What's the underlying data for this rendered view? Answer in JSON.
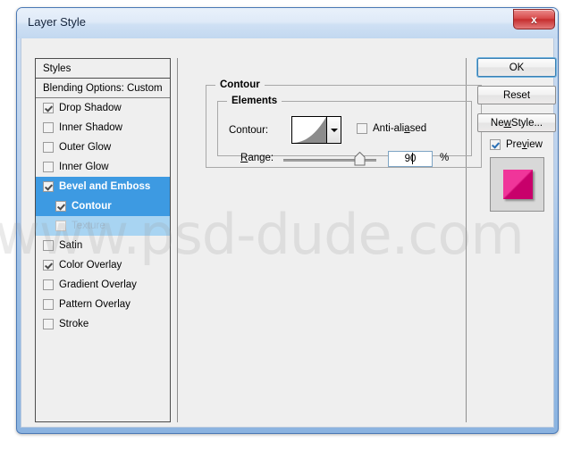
{
  "window": {
    "title": "Layer Style",
    "close_label": "x",
    "close_icon": "close-icon"
  },
  "styles_panel": {
    "header": "Styles",
    "blending_options": "Blending Options: Custom",
    "items": [
      {
        "label": "Drop Shadow",
        "checked": true,
        "selected": false,
        "sub": false,
        "disabled": false
      },
      {
        "label": "Inner Shadow",
        "checked": false,
        "selected": false,
        "sub": false,
        "disabled": false
      },
      {
        "label": "Outer Glow",
        "checked": false,
        "selected": false,
        "sub": false,
        "disabled": false
      },
      {
        "label": "Inner Glow",
        "checked": false,
        "selected": false,
        "sub": false,
        "disabled": false
      },
      {
        "label": "Bevel and Emboss",
        "checked": true,
        "selected": true,
        "sub": false,
        "disabled": false
      },
      {
        "label": "Contour",
        "checked": true,
        "selected": true,
        "sub": true,
        "disabled": false
      },
      {
        "label": "Texture",
        "checked": false,
        "selected": true,
        "sub": true,
        "disabled": true
      },
      {
        "label": "Satin",
        "checked": false,
        "selected": false,
        "sub": false,
        "disabled": false
      },
      {
        "label": "Color Overlay",
        "checked": true,
        "selected": false,
        "sub": false,
        "disabled": false
      },
      {
        "label": "Gradient Overlay",
        "checked": false,
        "selected": false,
        "sub": false,
        "disabled": false
      },
      {
        "label": "Pattern Overlay",
        "checked": false,
        "selected": false,
        "sub": false,
        "disabled": false
      },
      {
        "label": "Stroke",
        "checked": false,
        "selected": false,
        "sub": false,
        "disabled": false
      }
    ]
  },
  "main": {
    "group_title": "Contour",
    "elements_title": "Elements",
    "contour_label": "Contour:",
    "contour_preset_icon": "contour-curve-swatch",
    "contour_dropdown_icon": "chevron-down-icon",
    "antialiased": {
      "label": "Anti-aliased",
      "label_pre": "Anti-ali",
      "label_underlined": "a",
      "label_post": "sed",
      "checked": false
    },
    "range": {
      "label": "Range:",
      "label_underlined": "R",
      "label_pre": "",
      "label_post": "ange:",
      "value": "90",
      "unit": "%",
      "min": 0,
      "max": 100
    }
  },
  "buttons": {
    "ok": "OK",
    "reset": "Reset",
    "new_style_pre": "Ne",
    "new_style_underlined": "w",
    "new_style_post": " Style...",
    "new_style_full": "New Style..."
  },
  "preview": {
    "label_pre": "Pre",
    "label_underlined": "v",
    "label_post": "iew",
    "label_full": "Preview",
    "checked": true,
    "thumbnail_icon": "layer-preview-thumbnail",
    "thumbnail_color": "#e8238f",
    "thumbnail_bg": "#d8d8d8"
  },
  "watermark": {
    "text": "www.psd-dude.com"
  },
  "colors": {
    "selection_blue": "#3d9ae2",
    "selection_blue_dim": "#a8d4f2",
    "window_border": "#4a79b5",
    "panel_bg": "#efefef",
    "close_red": "#c62f2f"
  }
}
